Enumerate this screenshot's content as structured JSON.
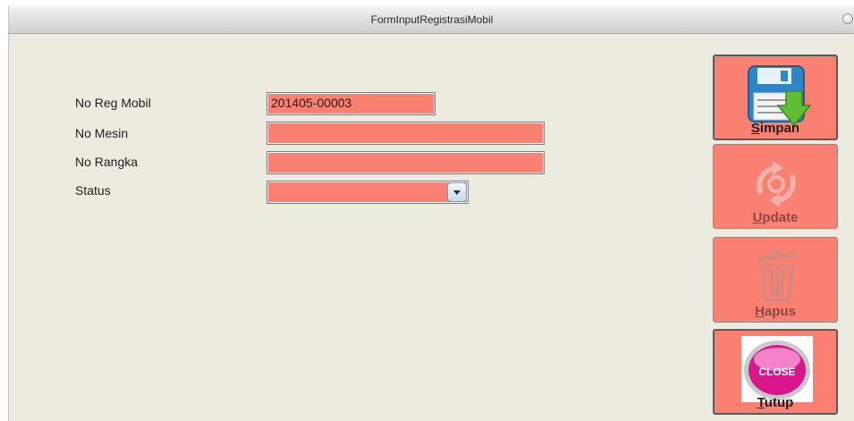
{
  "window": {
    "title": "FormInputRegistrasiMobil"
  },
  "form": {
    "no_reg_mobil": {
      "label": "No Reg Mobil",
      "value": "201405-00003"
    },
    "no_mesin": {
      "label": "No Mesin",
      "value": ""
    },
    "no_rangka": {
      "label": "No Rangka",
      "value": ""
    },
    "status": {
      "label": "Status",
      "value": ""
    }
  },
  "actions": {
    "simpan": {
      "mnemonic": "S",
      "rest": "impan",
      "enabled": true
    },
    "update": {
      "mnemonic": "U",
      "rest": "pdate",
      "enabled": false
    },
    "hapus": {
      "mnemonic": "H",
      "rest": "apus",
      "enabled": false
    },
    "tutup": {
      "mnemonic": "T",
      "rest": "utup",
      "enabled": true,
      "icon_text": "CLOSE"
    }
  },
  "colors": {
    "field_bg": "#fa8072",
    "panel_bg": "#ecebdf"
  }
}
